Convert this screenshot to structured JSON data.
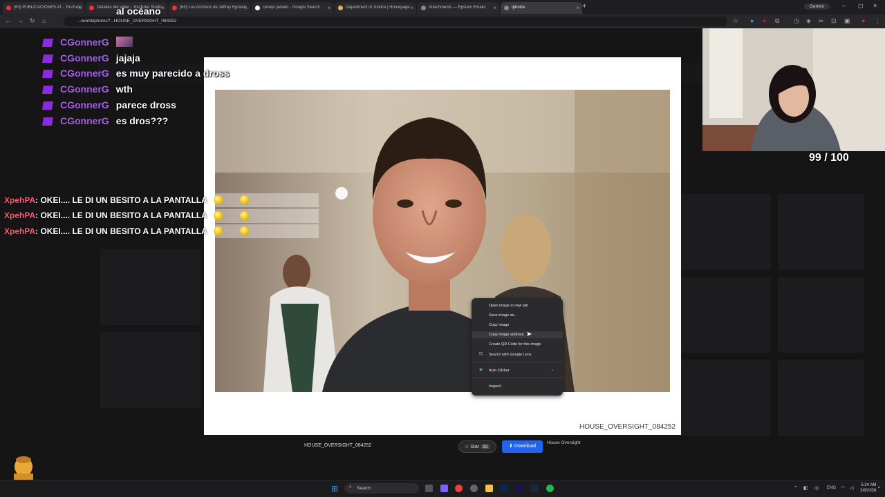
{
  "browser": {
    "tabs": [
      {
        "title": "(63) PUBLICACIONES #1 - YouTube",
        "color": "#ff2a2a"
      },
      {
        "title": "Detalles del video - YouTube Studio",
        "color": "#ff2a2a"
      },
      {
        "title": "(63) Los Archivos de Jeffrey Epstein",
        "color": "#ff2a2a"
      },
      {
        "title": "conejo pelado - Google Search",
        "color": "#ffffff"
      },
      {
        "title": "Department of Justice | Homepage",
        "color": "#ddb84a"
      },
      {
        "title": "Attachments — Epstein Emails",
        "color": "#888888"
      },
      {
        "title": "Iphotos",
        "color": "#888888"
      }
    ],
    "new_tab": "+",
    "gemini_label": "Gemini",
    "url": "...world/iphotos?...HOUSE_OVERSIGHT_084252"
  },
  "modal": {
    "caption": "HOUSE_OVERSIGHT_084252"
  },
  "context_menu": {
    "items": [
      {
        "label": "Open image in new tab"
      },
      {
        "label": "Save image as..."
      },
      {
        "label": "Copy image"
      },
      {
        "label": "Copy image address"
      },
      {
        "label": "Create QR Code for this image"
      },
      {
        "label": "Search with Google Lens"
      },
      {
        "label": "Auto Clicker"
      },
      {
        "label": "Inspect"
      }
    ]
  },
  "chat": {
    "top_text": "al océano",
    "lines": [
      {
        "user": "CGonnerG",
        "msg": ""
      },
      {
        "user": "CGonnerG",
        "msg": "jajaja"
      },
      {
        "user": "CGonnerG",
        "msg": "es muy parecido a dross"
      },
      {
        "user": "CGonnerG",
        "msg": "wth"
      },
      {
        "user": "CGonnerG",
        "msg": "parece dross"
      },
      {
        "user": "CGonnerG",
        "msg": "es dros???"
      }
    ],
    "xlines": [
      {
        "user": "XpehPA",
        "msg": ": OKEI.... LE DI UN BESITO A LA PANTALLA"
      },
      {
        "user": "XpehPA",
        "msg": ": OKEI.... LE DI UN BESITO A LA PANTALLA"
      },
      {
        "user": "XpehPA",
        "msg": ": OKEI.... LE DI UN BESITO A LA PANTALLA"
      }
    ]
  },
  "counter": "99 / 100",
  "bottom_bar": {
    "name": "HOUSE_OVERSIGHT_084252",
    "star_label": "Star",
    "star_count": "50",
    "download_label": "Download",
    "house_label": "House Oversight"
  },
  "taskbar": {
    "search_placeholder": "Search",
    "lang": "ENG",
    "time": "5:24 AM",
    "date": "2/8/2026"
  }
}
